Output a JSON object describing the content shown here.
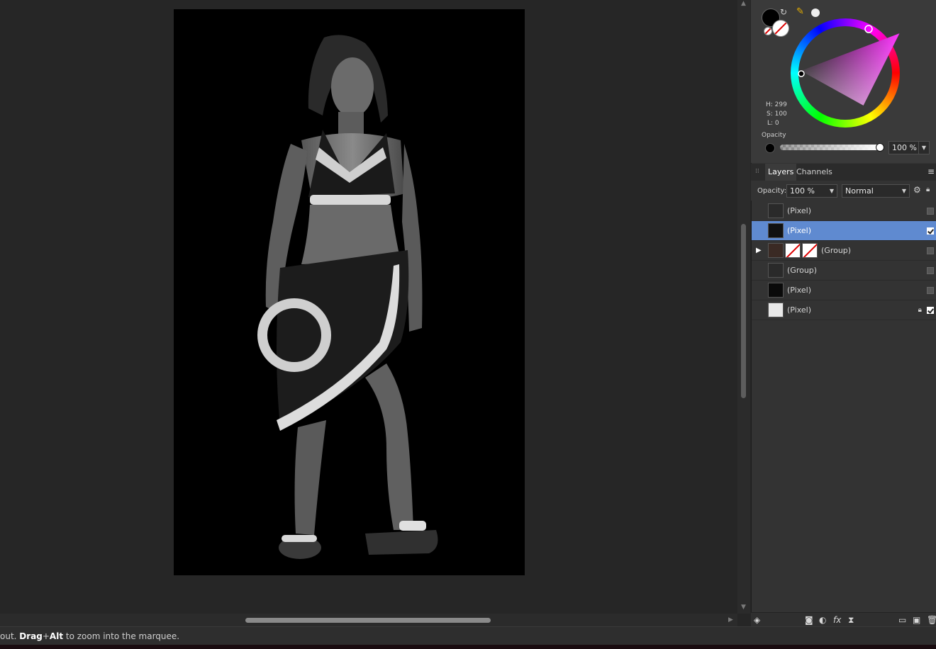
{
  "status": {
    "prefix": "out. ",
    "key1": "Drag",
    "plus": "+",
    "key2": "Alt",
    "suffix": " to zoom into the marquee."
  },
  "color": {
    "hsl": {
      "h": "H: 299",
      "s": "S: 100",
      "l": "L: 0"
    },
    "opacity_label": "Opacity",
    "opacity_value": "100 %",
    "hue_color": "#ff33ff",
    "primary_color": "#000000"
  },
  "tabs": [
    {
      "label": "Layers",
      "active": true
    },
    {
      "label": "Channels",
      "active": false
    }
  ],
  "layer_options": {
    "opacity_label": "Opacity:",
    "opacity_value": "100 %",
    "blend_mode": "Normal"
  },
  "layers": [
    {
      "name": "(Pixel)",
      "selected": false,
      "visible": false,
      "locked": false,
      "expandable": false
    },
    {
      "name": "(Pixel)",
      "selected": true,
      "visible": true,
      "locked": false,
      "expandable": false
    },
    {
      "name": "(Group)",
      "selected": false,
      "visible": false,
      "locked": false,
      "expandable": true
    },
    {
      "name": "(Group)",
      "selected": false,
      "visible": false,
      "locked": false,
      "expandable": false
    },
    {
      "name": "(Pixel)",
      "selected": false,
      "visible": false,
      "locked": false,
      "expandable": false
    },
    {
      "name": "(Pixel)",
      "selected": false,
      "visible": true,
      "locked": true,
      "expandable": false
    }
  ],
  "icons": {
    "swap": "swap-colors-icon",
    "picker": "color-picker-icon",
    "menu": "panel-menu-icon"
  }
}
